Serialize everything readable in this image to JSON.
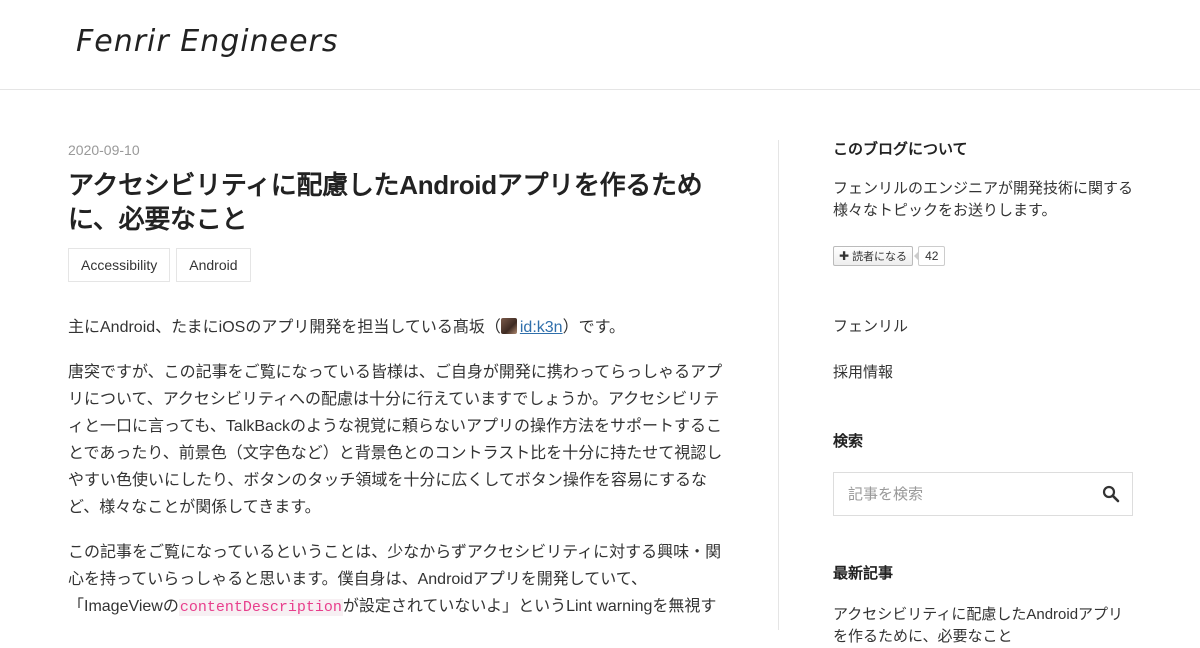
{
  "site": {
    "title": "Fenrir Engineers"
  },
  "entry": {
    "date": "2020-09-10",
    "title": "アクセシビリティに配慮したAndroidアプリを作るために、必要なこと",
    "tags": [
      "Accessibility",
      "Android"
    ],
    "intro": {
      "before": "主にAndroid、たまにiOSのアプリ開発を担当している髙坂（",
      "user": "id:k3n",
      "after": "）です。"
    },
    "para2": "唐突ですが、この記事をご覧になっている皆様は、ご自身が開発に携わってらっしゃるアプリについて、アクセシビリティへの配慮は十分に行えていますでしょうか。アクセシビリティと一口に言っても、TalkBackのような視覚に頼らないアプリの操作方法をサポートすることであったり、前景色（文字色など）と背景色とのコントラスト比を十分に持たせて視認しやすい色使いにしたり、ボタンのタッチ領域を十分に広くしてボタン操作を容易にするなど、様々なことが関係してきます。",
    "para3": {
      "text1": "この記事をご覧になっているということは、少なからずアクセシビリティに対する興味・関心を持っていらっしゃると思います。僕自身は、Androidアプリを開発していて、「ImageViewの",
      "code": "contentDescription",
      "text2": "が設定されていないよ」というLint warningを無視す"
    }
  },
  "sidebar": {
    "about": {
      "heading": "このブログについて",
      "text": "フェンリルのエンジニアが開発技術に関する様々なトピックをお送りします。",
      "subscribe_label": "読者になる",
      "subscribe_count": "42"
    },
    "links": [
      "フェンリル",
      "採用情報"
    ],
    "search": {
      "heading": "検索",
      "placeholder": "記事を検索"
    },
    "recent": {
      "heading": "最新記事",
      "items": [
        "アクセシビリティに配慮したAndroidアプリを作るために、必要なこと"
      ]
    }
  },
  "colors": {
    "link": "#2f6fab",
    "code": "#e83e8c",
    "border": "#e5e5e5"
  },
  "icons": {
    "search": "search-icon",
    "plus": "plus-icon"
  }
}
